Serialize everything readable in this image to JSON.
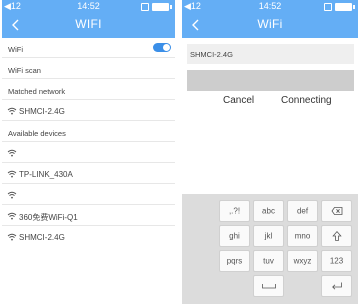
{
  "left": {
    "status": {
      "signal": "◀12",
      "time": "14:52"
    },
    "title": "WIFI",
    "rows": {
      "wifi": "WiFi",
      "scan": "WiFi scan",
      "matched": "Matched network",
      "matched_ssid": "SHMCI-2.4G",
      "available": "Available devices",
      "network_1": "",
      "network_2": "TP-LINK_430A",
      "network_3": "",
      "network_4": "360免费WiFi-Q1",
      "network_5": "SHMCI-2.4G"
    },
    "wifi_enabled": true
  },
  "right": {
    "status": {
      "signal": "◀12",
      "time": "14:52"
    },
    "title": "WiFi",
    "ssid": "SHMCI-2.4G",
    "password": "",
    "cancel_label": "Cancel",
    "connect_label": "Connecting"
  },
  "keyboard": {
    "keys": {
      "punct": ",.?!",
      "abc": "abc",
      "def": "def",
      "ghi": "ghi",
      "jkl": "jkl",
      "mno": "mno",
      "pqrs": "pqrs",
      "tuv": "tuv",
      "wxyz": "wxyz",
      "num": "123"
    },
    "icons": [
      "backspace-icon",
      "shift-icon",
      "space-icon",
      "enter-icon"
    ]
  },
  "colors": {
    "accent": "#64aef5",
    "toggle": "#3b8fe8",
    "field_bg": "#efefef",
    "password_bg": "#cdcdcd",
    "keyboard_bg": "#dcdcdc"
  }
}
